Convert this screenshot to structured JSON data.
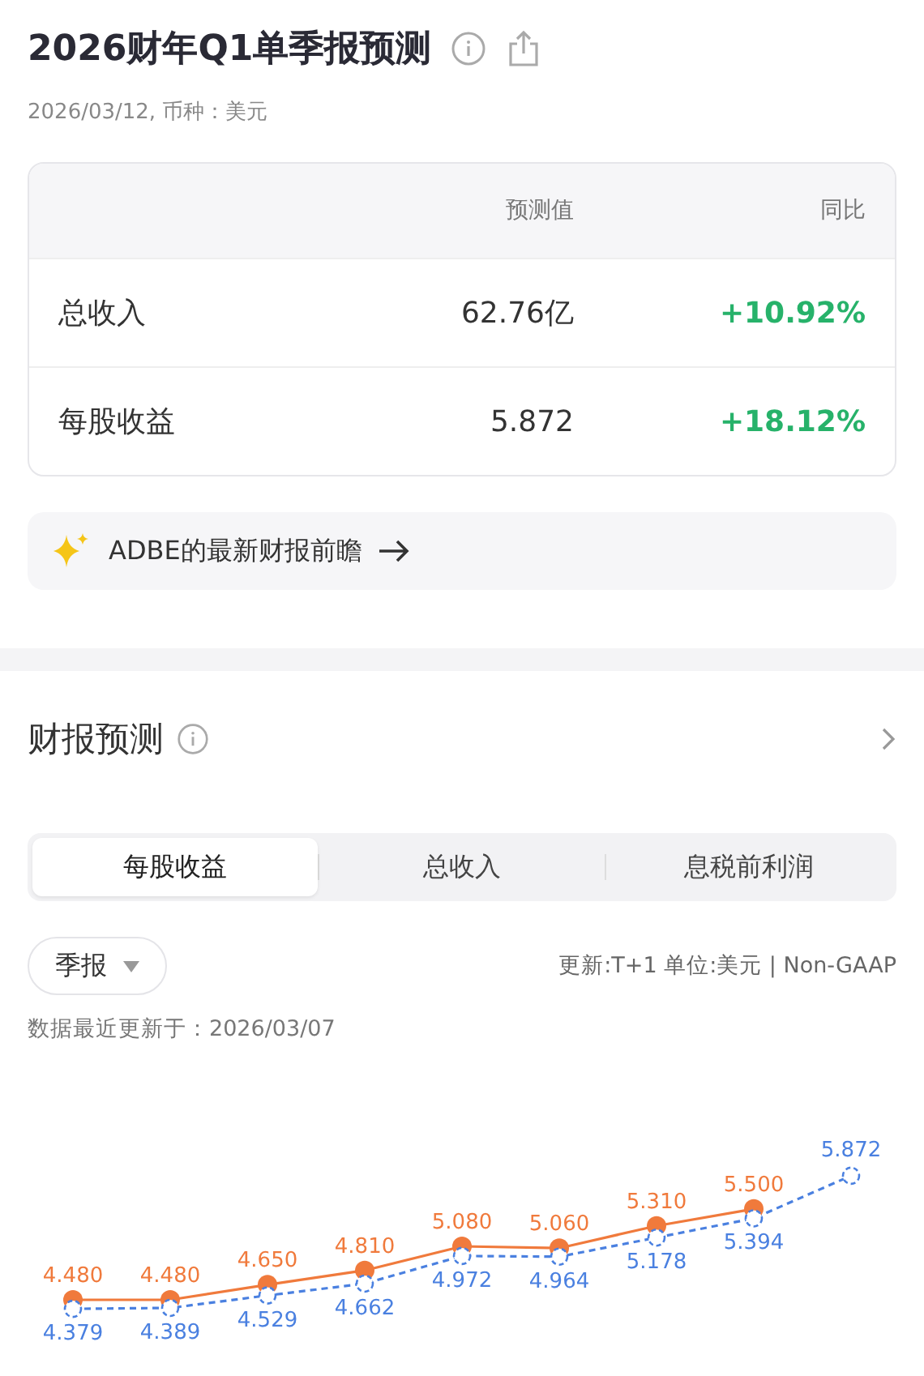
{
  "header": {
    "title": "2026财年Q1单季报预测",
    "subtitle": "2026/03/12, 币种：美元"
  },
  "table": {
    "columns": [
      "",
      "预测值",
      "同比"
    ],
    "rows": [
      {
        "name": "总收入",
        "value": "62.76亿",
        "change": "+10.92%"
      },
      {
        "name": "每股收益",
        "value": "5.872",
        "change": "+18.12%"
      }
    ]
  },
  "preview_link": {
    "label": "ADBE的最新财报前瞻"
  },
  "forecast": {
    "title": "财报预测",
    "tabs": [
      {
        "label": "每股收益",
        "selected": true
      },
      {
        "label": "总收入",
        "selected": false
      },
      {
        "label": "息税前利润",
        "selected": false
      }
    ],
    "period_dropdown": {
      "value": "季报"
    },
    "unit_note": "更新:T+1 单位:美元 | Non-GAAP",
    "updated": "数据最近更新于：2026/03/07",
    "chart_data": {
      "type": "line",
      "data_labels": true,
      "series": [
        {
          "color": "#f07a3c",
          "marker": "circle",
          "line_style": "solid",
          "values": [
            4.48,
            4.48,
            4.65,
            4.81,
            5.08,
            5.06,
            5.31,
            5.5,
            null
          ],
          "value_labels": [
            "4.480",
            "4.480",
            "4.650",
            "4.810",
            "5.080",
            "5.060",
            "5.310",
            "5.500",
            null
          ]
        },
        {
          "color": "#4a80e0",
          "marker": "circle",
          "line_style": "dashed",
          "values": [
            4.379,
            4.389,
            4.529,
            4.662,
            4.972,
            4.964,
            5.178,
            5.394,
            5.872
          ],
          "value_labels": [
            "4.379",
            "4.389",
            "4.529",
            "4.662",
            "4.972",
            "4.964",
            "5.178",
            "5.394",
            "5.872"
          ]
        }
      ]
    }
  }
}
